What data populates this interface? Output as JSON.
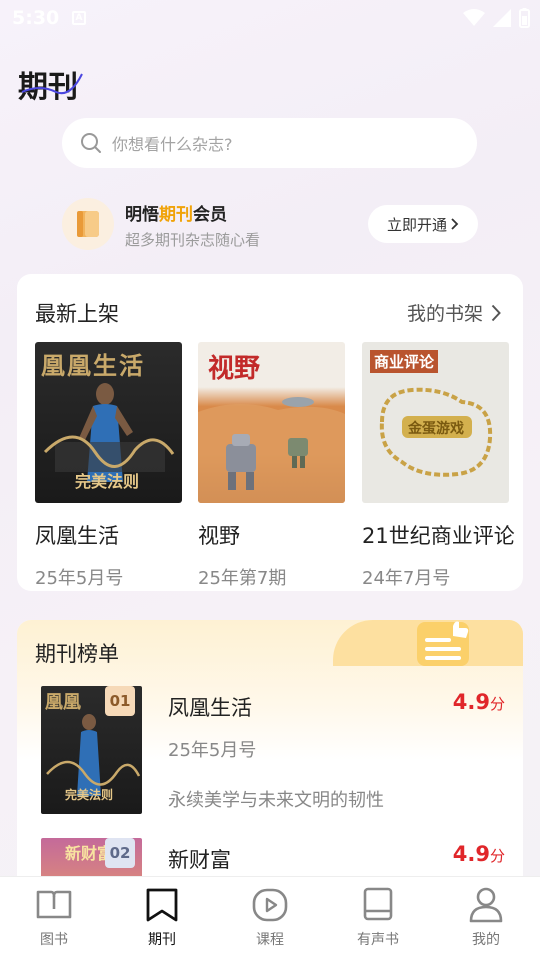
{
  "status_bar": {
    "time": "5:30",
    "notification_glyph": "A"
  },
  "page": {
    "title": "期刊"
  },
  "search": {
    "placeholder": "你想看什么杂志?"
  },
  "vip": {
    "title_prefix": "明悟",
    "title_highlight": "期刊",
    "title_suffix": "会员",
    "subtitle": "超多期刊杂志随心看",
    "button_label": "立即开通"
  },
  "latest": {
    "title": "最新上架",
    "shelf_link": "我的书架",
    "books": [
      {
        "name": "凤凰生活",
        "issue": "25年5月号",
        "cover_title": "凰凰生活",
        "cover_text": "完美法则"
      },
      {
        "name": "视野",
        "issue": "25年第7期",
        "cover_title": "视野"
      },
      {
        "name": "21世纪商业评论",
        "issue": "24年7月号",
        "cover_title": "商业评论",
        "cover_text": "金蛋游戏"
      }
    ]
  },
  "ranking": {
    "title": "期刊榜单",
    "items": [
      {
        "rank": "01",
        "name": "凤凰生活",
        "issue": "25年5月号",
        "desc": "永续美学与未来文明的韧性",
        "score": "4.9",
        "unit": "分",
        "cover_title": "凰凰",
        "cover_text": "完美法则"
      },
      {
        "rank": "02",
        "name": "新财富",
        "score": "4.9",
        "unit": "分",
        "cover_title": "新财富"
      }
    ]
  },
  "tabs": [
    {
      "label": "图书",
      "icon": "open-book-icon",
      "active": false
    },
    {
      "label": "期刊",
      "icon": "bookmark-icon",
      "active": true
    },
    {
      "label": "课程",
      "icon": "play-icon",
      "active": false
    },
    {
      "label": "有声书",
      "icon": "audiobook-icon",
      "active": false
    },
    {
      "label": "我的",
      "icon": "user-icon",
      "active": false
    }
  ],
  "colors": {
    "accent_gold": "#f0a30a",
    "score_red": "#e0262a",
    "rank_bg": "#fef1d3"
  }
}
